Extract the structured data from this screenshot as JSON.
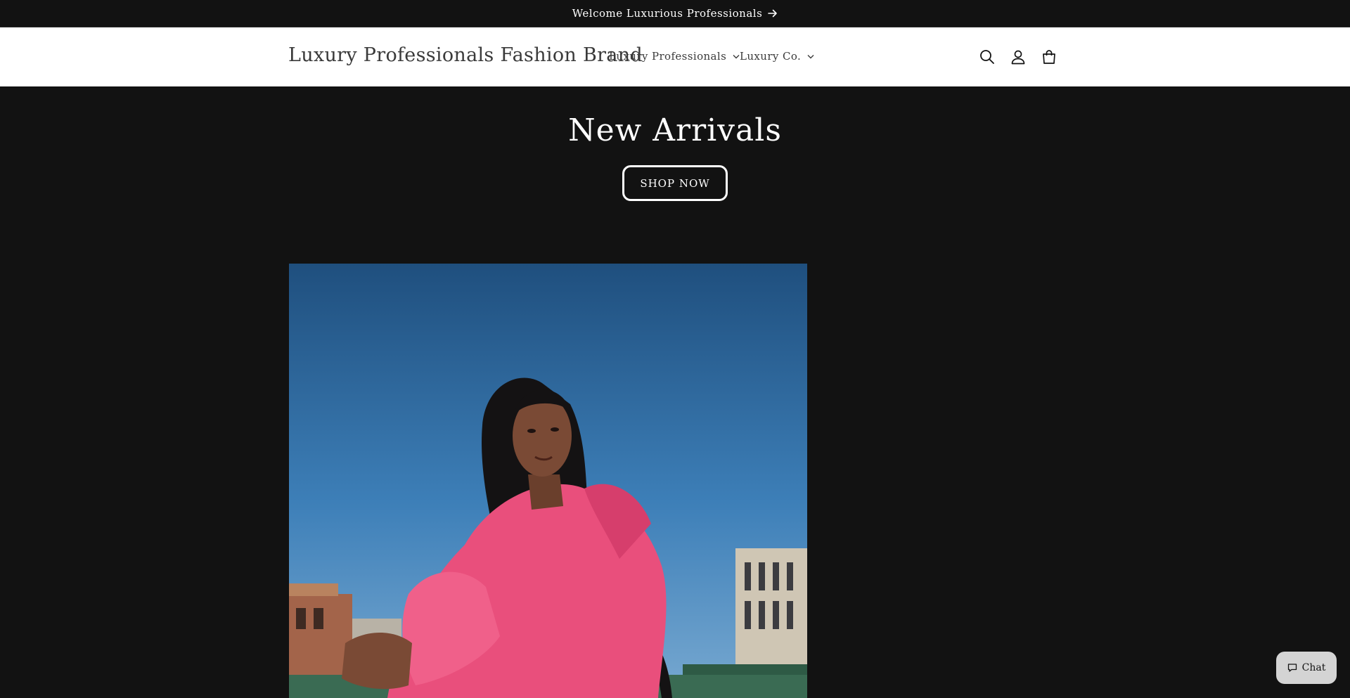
{
  "announcement": {
    "text": "Welcome Luxurious Professionals",
    "icon": "arrow-right-icon"
  },
  "header": {
    "brand": "Luxury Professionals Fashion Brand",
    "nav": [
      {
        "label": "Luxury Professionals",
        "icon": "chevron-down-icon"
      },
      {
        "label": "Luxury Co.",
        "icon": "chevron-down-icon"
      }
    ],
    "icons": [
      "search-icon",
      "account-icon",
      "cart-icon"
    ]
  },
  "hero": {
    "title": "New Arrivals",
    "button_label": "SHOP NOW"
  },
  "featured_image": {
    "subject": "woman in pink jacket against blue sky"
  },
  "chat": {
    "label": "Chat",
    "icon": "chat-bubble-icon"
  },
  "colors": {
    "background": "#121212",
    "header_bg": "#ffffff",
    "text_light": "#ffffff",
    "text_dark": "#3a3a3a",
    "chat_bg": "#d4d4d4",
    "jacket_pink": "#e94f7c",
    "sky_blue": "#3d7fb8"
  }
}
